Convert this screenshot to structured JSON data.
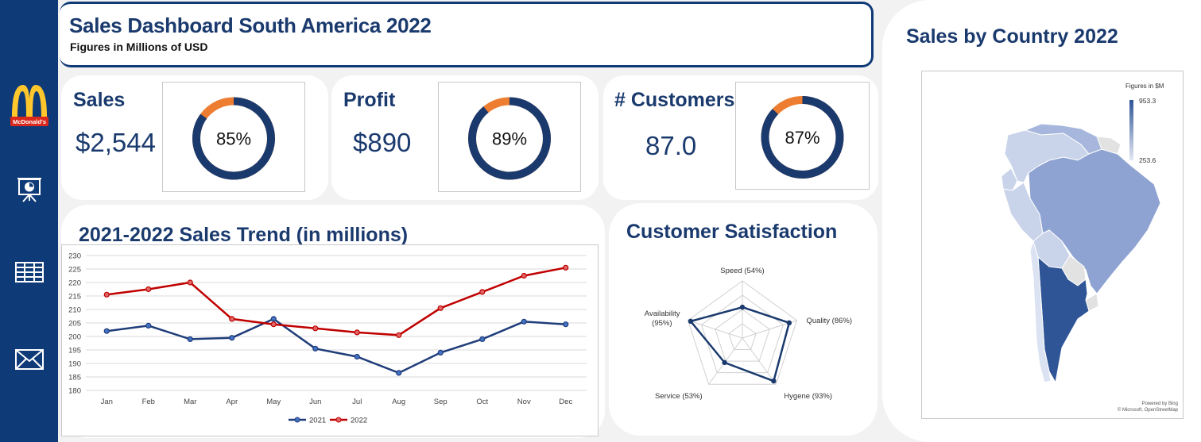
{
  "header": {
    "title": "Sales Dashboard South America 2022",
    "subtitle": "Figures in Millions of USD"
  },
  "sidebar": {
    "logo_text": "McDonald's",
    "items": [
      {
        "icon": "presentation-icon"
      },
      {
        "icon": "table-icon"
      },
      {
        "icon": "mail-icon"
      }
    ]
  },
  "kpis": [
    {
      "title": "Sales",
      "value": "$2,544",
      "percent_label": "85%",
      "percent": 0.85
    },
    {
      "title": "Profit",
      "value": "$890",
      "percent_label": "89%",
      "percent": 0.89
    },
    {
      "title": "# Customers",
      "value": "87.0",
      "percent_label": "87%",
      "percent": 0.87
    }
  ],
  "trend": {
    "title": "2021-2022 Sales Trend (in millions)"
  },
  "satisfaction": {
    "title": "Customer Satisfaction"
  },
  "map": {
    "title": "Sales by Country 2022",
    "legend_title": "Figures in $M",
    "legend_max": "953.3",
    "legend_min": "253.6",
    "credit_line1": "Powered by Bing",
    "credit_line2": "© Microsoft, OpenStreetMap"
  },
  "colors": {
    "navy": "#1a3a6e",
    "blue_2021": "#1f3d7a",
    "red_2022": "#c00000",
    "orange": "#ed7d31",
    "sidebar": "#0f3a78"
  },
  "chart_data": [
    {
      "type": "line",
      "title": "2021-2022 Sales Trend (in millions)",
      "categories": [
        "Jan",
        "Feb",
        "Mar",
        "Apr",
        "May",
        "Jun",
        "Jul",
        "Aug",
        "Sep",
        "Oct",
        "Nov",
        "Dec"
      ],
      "series": [
        {
          "name": "2021",
          "values": [
            202,
            204,
            199,
            199.5,
            206.5,
            195.5,
            192.5,
            186.5,
            194,
            199,
            205.5,
            204.5
          ]
        },
        {
          "name": "2022",
          "values": [
            215.5,
            217.5,
            220,
            206.5,
            204.5,
            203,
            201.5,
            200.5,
            210.5,
            216.5,
            222.5,
            225.5
          ]
        }
      ],
      "ylim": [
        180,
        230
      ],
      "yticks": [
        180,
        185,
        190,
        195,
        200,
        205,
        210,
        215,
        220,
        225,
        230
      ],
      "grid": true,
      "legend": "bottom"
    },
    {
      "type": "radar",
      "title": "Customer Satisfaction",
      "axes": [
        {
          "label": "Speed (54%)",
          "value": 54
        },
        {
          "label": "Quality (86%)",
          "value": 86
        },
        {
          "label": "Hygene (93%)",
          "value": 93
        },
        {
          "label": "Service (53%)",
          "value": 53
        },
        {
          "label": "Availability",
          "label2": "(95%)",
          "value": 95
        }
      ],
      "max": 100
    }
  ]
}
